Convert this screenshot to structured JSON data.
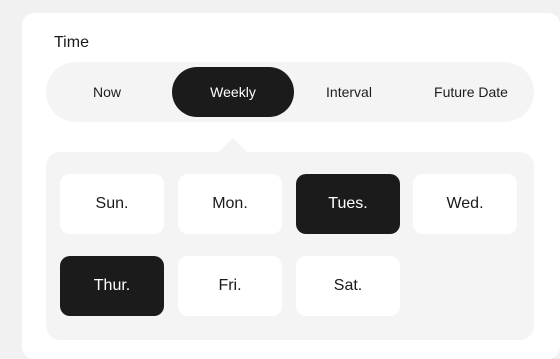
{
  "section": {
    "title": "Time"
  },
  "modes": [
    {
      "label": "Now",
      "active": false
    },
    {
      "label": "Weekly",
      "active": true
    },
    {
      "label": "Interval",
      "active": false
    },
    {
      "label": "Future Date",
      "active": false
    }
  ],
  "days": [
    {
      "label": "Sun.",
      "selected": false
    },
    {
      "label": "Mon.",
      "selected": false
    },
    {
      "label": "Tues.",
      "selected": true
    },
    {
      "label": "Wed.",
      "selected": false
    },
    {
      "label": "Thur.",
      "selected": true
    },
    {
      "label": "Fri.",
      "selected": false
    },
    {
      "label": "Sat.",
      "selected": false
    }
  ]
}
